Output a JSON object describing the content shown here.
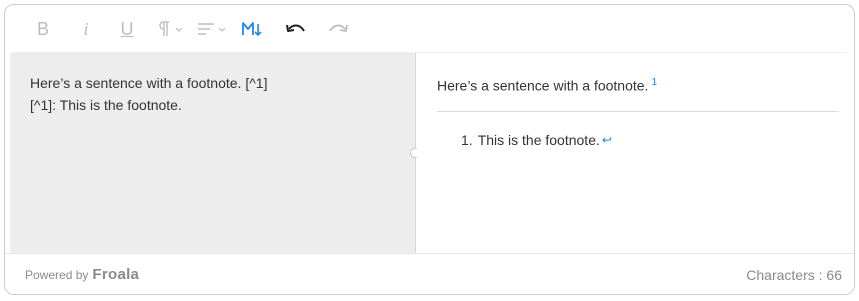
{
  "toolbar": {
    "bold_label": "B",
    "italic_label": "i",
    "underline_label": "U",
    "buttons": [
      {
        "name": "bold",
        "icon": "bold-icon"
      },
      {
        "name": "italic",
        "icon": "italic-icon"
      },
      {
        "name": "underline",
        "icon": "underline-icon"
      },
      {
        "name": "paragraph-format",
        "icon": "pilcrow-icon"
      },
      {
        "name": "align",
        "icon": "align-icon"
      },
      {
        "name": "markdown",
        "icon": "markdown-icon"
      },
      {
        "name": "undo",
        "icon": "undo-icon"
      },
      {
        "name": "redo",
        "icon": "redo-icon"
      }
    ],
    "colors": {
      "inactive": "#bdbdbd",
      "markdown_active": "#1e88e5",
      "undo_active": "#222222"
    }
  },
  "source": {
    "lines": [
      "Here’s a sentence with a footnote. [^1]",
      "[^1]: This is the footnote."
    ]
  },
  "preview": {
    "text": "Here’s a sentence with a footnote.",
    "footnote_ref": "1",
    "footnotes": [
      {
        "number": "1.",
        "text": "This is the footnote.",
        "backref": "↩"
      }
    ]
  },
  "footer": {
    "powered_by": "Powered by",
    "brand": "Froala",
    "characters": "Characters : 66"
  },
  "colors": {
    "source_pane_bg": "#ededed",
    "link": "#1e88e5",
    "text": "#333333",
    "muted": "#8a8a8a"
  }
}
